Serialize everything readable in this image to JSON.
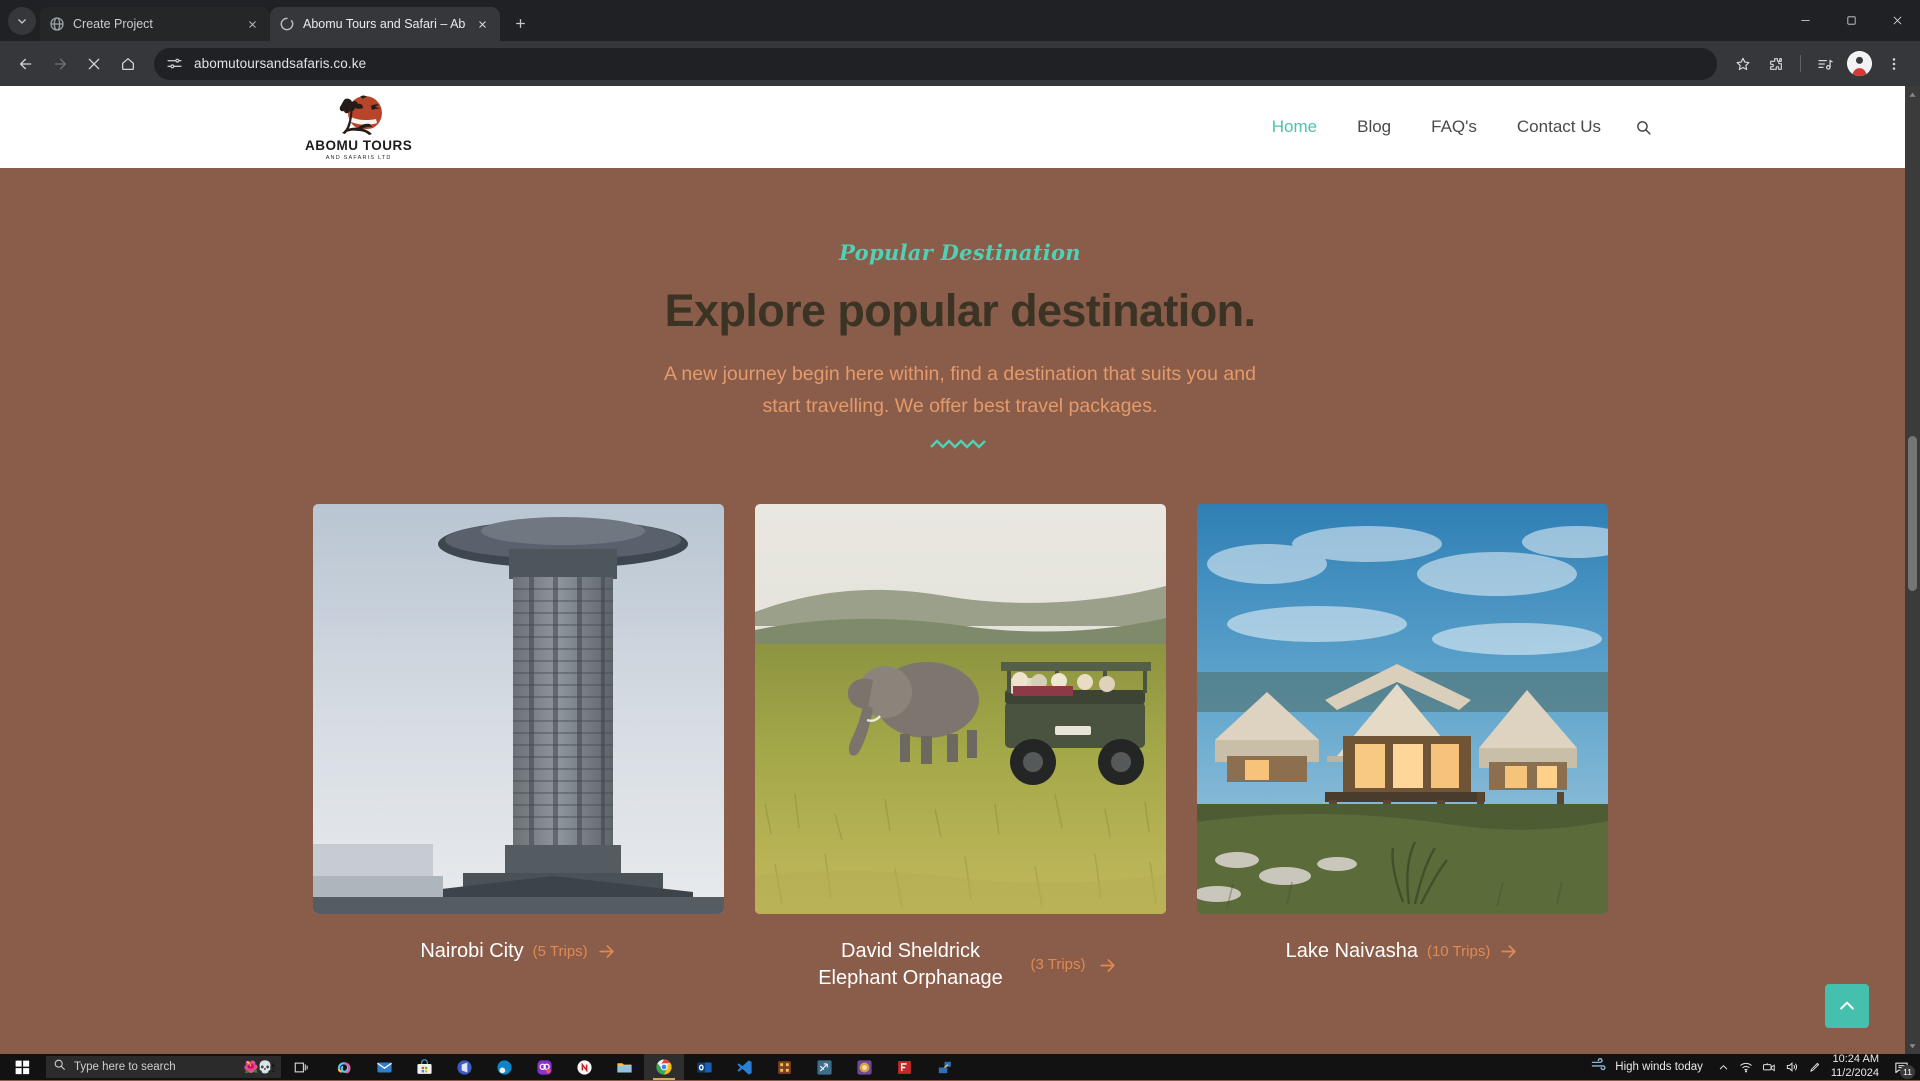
{
  "browser": {
    "tabs": [
      {
        "title": "Create Project",
        "favicon": "globe-icon",
        "active": false
      },
      {
        "title": "Abomu Tours and Safari – Abom",
        "favicon": "loading-spinner-icon",
        "active": true
      }
    ],
    "url": "abomutoursandsafaris.co.ke",
    "new_tab_label": "+",
    "controls": {
      "minimize": "—",
      "maximize": "□",
      "close": "✕"
    }
  },
  "site": {
    "logo": {
      "name": "ABOMU TOURS",
      "subtitle": "AND SAFARIS LTD"
    },
    "nav": [
      {
        "label": "Home",
        "active": true
      },
      {
        "label": "Blog",
        "active": false
      },
      {
        "label": "FAQ's",
        "active": false
      },
      {
        "label": "Contact Us",
        "active": false
      }
    ],
    "nav_search_icon": "search-icon"
  },
  "hero": {
    "eyebrow": "Popular Destination",
    "heading": "Explore popular destination.",
    "lede_line1": "A new journey begin here within, find a destination that suits you and",
    "lede_line2": "start travelling. We offer best travel packages."
  },
  "destinations": [
    {
      "title": "Nairobi City",
      "trips": "(5 Trips)",
      "image": "nairobi-kicc-tower-photo",
      "wrap": false
    },
    {
      "title": "David Sheldrick Elephant Orphanage",
      "trips": "(3 Trips)",
      "image": "elephant-safari-jeep-photo",
      "wrap": true
    },
    {
      "title": "Lake Naivasha",
      "trips": "(10 Trips)",
      "image": "luxury-safari-tent-camp-photo",
      "wrap": false
    }
  ],
  "scroll_top_label": "scroll to top",
  "colors": {
    "page_background": "#8a5c4a",
    "accent_teal": "#4fd1b5",
    "accent_orange": "#e08a52",
    "heading_dark": "#3b3324"
  },
  "taskbar": {
    "search_placeholder": "Type here to search",
    "apps": [
      "copilot-icon",
      "mail-icon",
      "microsoft-store-icon",
      "office-icon",
      "edge-icon",
      "figma-purple-app-icon",
      "onenote-icon",
      "file-explorer-icon",
      "chrome-icon",
      "outlook-icon",
      "vscode-icon",
      "winrar-icon",
      "blue-arrows-app-icon",
      "jetbrains-app-icon",
      "filezilla-icon",
      "network-tool-icon"
    ],
    "weather": "High winds today",
    "time": "10:24 AM",
    "date": "11/2/2024",
    "notification_count": "11"
  }
}
